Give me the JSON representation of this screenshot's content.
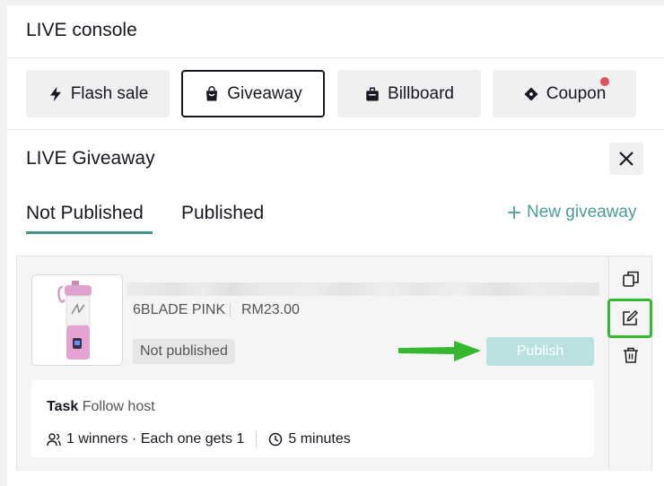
{
  "console": {
    "title": "LIVE console"
  },
  "tools": [
    {
      "label": "Flash sale",
      "icon": "lightning-icon"
    },
    {
      "label": "Giveaway",
      "icon": "gift-bag-icon",
      "active": true
    },
    {
      "label": "Billboard",
      "icon": "billboard-icon"
    },
    {
      "label": "Coupon",
      "icon": "coupon-icon",
      "has_dot": true
    }
  ],
  "giveaway": {
    "title": "LIVE Giveaway",
    "tabs": [
      "Not Published",
      "Published"
    ],
    "new_label": "New giveaway"
  },
  "item": {
    "variant": "6BLADE PINK",
    "price": "RM23.00",
    "status": "Not published",
    "publish_label": "Publish",
    "task_label": "Task",
    "task_value": "Follow host",
    "winners_text": "1 winners · Each one gets 1",
    "duration_text": "5 minutes"
  },
  "colors": {
    "accent": "#43958f",
    "publish_disabled": "#b9e1df",
    "highlight": "#35b830",
    "dot": "#e0525b"
  }
}
